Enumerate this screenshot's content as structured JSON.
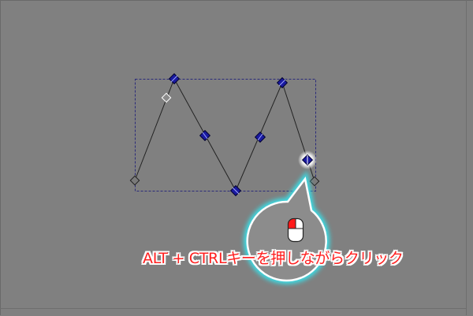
{
  "canvas": {
    "background": "#808080"
  },
  "selection": {
    "border_color": "#2a2a7a",
    "style": "dashed"
  },
  "path": {
    "stroke_color": "#222222",
    "node_selected_color": "#1a1aa0",
    "node_unselected_color": "#7a7a7a"
  },
  "hint": {
    "text": "ALT + CTRLキーを押しながらクリック",
    "text_color": "#ff2020",
    "outline_color": "#ffffff",
    "icon": "mouse-left-click-icon",
    "bubble_fill": "#8c8c8c",
    "bubble_border": "#ffffff",
    "bubble_glow": "#33e8f2"
  },
  "cursor": {
    "highlight_color": "#ffffff"
  }
}
